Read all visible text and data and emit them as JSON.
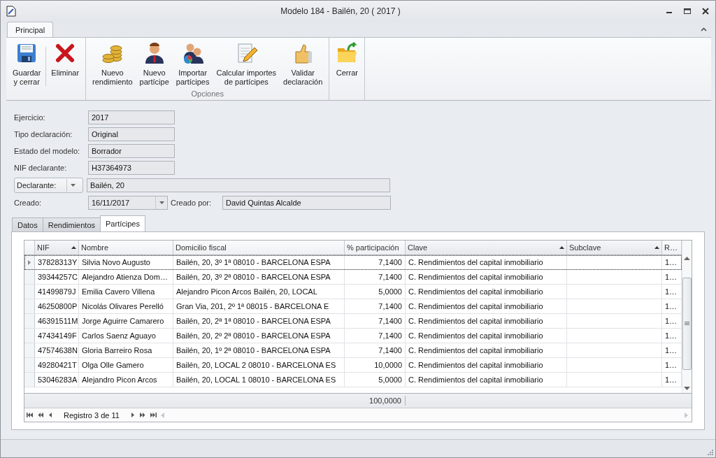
{
  "window": {
    "title": "Modelo 184 - Bailén, 20 ( 2017 )"
  },
  "ribbon": {
    "tabs": [
      {
        "label": "Principal",
        "selected": true
      }
    ],
    "groups": [
      {
        "buttons": [
          "Guardar\ny cerrar",
          "Eliminar"
        ]
      },
      {
        "label": "Opciones",
        "buttons": [
          "Nuevo\nrendimiento",
          "Nuevo\npartícipe",
          "Importar\npartícipes",
          "Calcular importes\nde partícipes",
          "Validar\ndeclaración"
        ]
      },
      {
        "buttons": [
          "Cerrar"
        ]
      }
    ]
  },
  "form": {
    "fields": [
      {
        "label": "Ejercicio:",
        "value": "2017"
      },
      {
        "label": "Tipo declaración:",
        "value": "Original"
      },
      {
        "label": "Estado del modelo:",
        "value": "Borrador"
      },
      {
        "label": "NIF declarante:",
        "value": "H37364973"
      }
    ],
    "declarante": {
      "selector": "Declarante:",
      "value": "Bailén, 20"
    },
    "created": {
      "label": "Creado:",
      "date": "16/11/2017",
      "by_label": "Creado por:",
      "by": "David Quintas Alcalde"
    }
  },
  "detail_tabs": [
    {
      "label": "Datos",
      "selected": false
    },
    {
      "label": "Rendimientos",
      "selected": false
    },
    {
      "label": "Partícipes",
      "selected": true
    }
  ],
  "grid": {
    "columns": [
      {
        "label": "NIF",
        "sorted": true,
        "kind": "text"
      },
      {
        "label": "Nombre",
        "sorted": false,
        "kind": "text"
      },
      {
        "label": "Domicilio fiscal",
        "sorted": false,
        "kind": "text"
      },
      {
        "label": "% participación",
        "sorted": false,
        "kind": "number"
      },
      {
        "label": "Clave",
        "sorted": true,
        "kind": "text"
      },
      {
        "label": "Subclave",
        "sorted": true,
        "kind": "text"
      },
      {
        "label": "R…",
        "sorted": false,
        "kind": "text"
      }
    ],
    "rows": [
      {
        "selected": true,
        "cells": [
          "37828313Y",
          "Silvia Novo Augusto",
          "Bailén, 20, 3º 1ª 08010 - BARCELONA ESPA",
          "7,1400",
          "C. Rendimientos del capital inmobiliario",
          "",
          "1…"
        ]
      },
      {
        "selected": false,
        "cells": [
          "39344257C",
          "Alejandro Atienza Dom…",
          "Bailén, 20, 3º 2ª 08010 - BARCELONA ESPA",
          "7,1400",
          "C. Rendimientos del capital inmobiliario",
          "",
          "1…"
        ]
      },
      {
        "selected": false,
        "cells": [
          "41499879J",
          "Emilia Cavero Villena",
          "Alejandro Picon Arcos Bailén, 20, LOCAL",
          "5,0000",
          "C. Rendimientos del capital inmobiliario",
          "",
          "1…"
        ]
      },
      {
        "selected": false,
        "cells": [
          "46250800P",
          "Nicolás Olivares Perelló",
          "Gran Via, 201, 2º 1ª 08015 - BARCELONA E",
          "7,1400",
          "C. Rendimientos del capital inmobiliario",
          "",
          "1…"
        ]
      },
      {
        "selected": false,
        "cells": [
          "46391511M",
          "Jorge Aguirre Camarero",
          "Bailén, 20, 2ª 1ª 08010 - BARCELONA ESPA",
          "7,1400",
          "C. Rendimientos del capital inmobiliario",
          "",
          "1…"
        ]
      },
      {
        "selected": false,
        "cells": [
          "47434149F",
          "Carlos Saenz Aguayo",
          "Bailén, 20, 2º 2ª 08010 - BARCELONA ESPA",
          "7,1400",
          "C. Rendimientos del capital inmobiliario",
          "",
          "1…"
        ]
      },
      {
        "selected": false,
        "cells": [
          "47574638N",
          "Gloria Barreiro Rosa",
          "Bailén, 20, 1º 2ª 08010 - BARCELONA ESPA",
          "7,1400",
          "C. Rendimientos del capital inmobiliario",
          "",
          "1…"
        ]
      },
      {
        "selected": false,
        "cells": [
          "49280421T",
          "Olga Olle Gamero",
          "Bailén, 20, LOCAL 2 08010 - BARCELONA ES",
          "10,0000",
          "C. Rendimientos del capital inmobiliario",
          "",
          "1…"
        ]
      },
      {
        "selected": false,
        "cells": [
          "53046283A",
          "Alejandro Picon Arcos",
          "Bailén, 20, LOCAL 1 08010 - BARCELONA ES",
          "5,0000",
          "C. Rendimientos del capital inmobiliario",
          "",
          "1…"
        ]
      }
    ],
    "total": "100,0000",
    "navigator": {
      "record": "Registro 3 de 11"
    }
  }
}
